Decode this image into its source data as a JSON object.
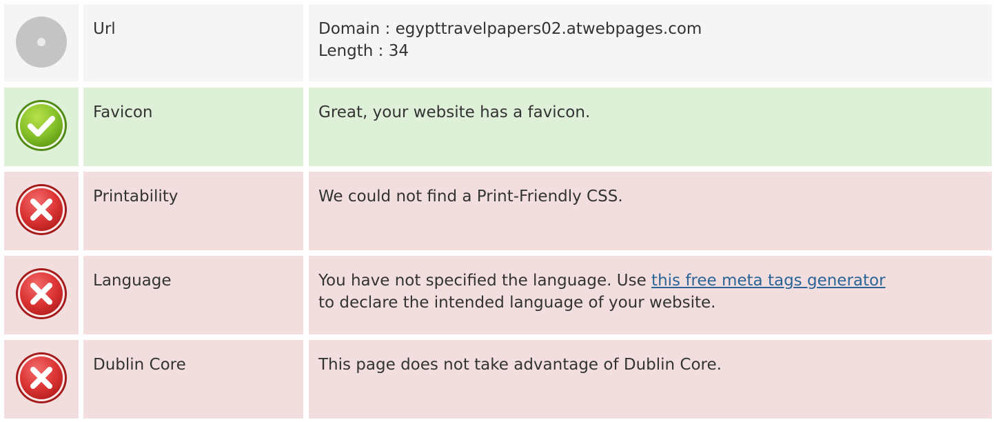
{
  "rows": [
    {
      "status": "neutral",
      "icon": "neutral-circle-icon",
      "label": "Url",
      "lines": [
        "Domain : egypttravelpapers02.atwebpages.com",
        "Length : 34"
      ]
    },
    {
      "status": "good",
      "icon": "check-circle-icon",
      "label": "Favicon",
      "text": "Great, your website has a favicon."
    },
    {
      "status": "bad",
      "icon": "error-x-icon",
      "label": "Printability",
      "text": "We could not find a Print-Friendly CSS."
    },
    {
      "status": "bad",
      "icon": "error-x-icon",
      "label": "Language",
      "text_before": "You have not specified the language. Use ",
      "link_text": "this free meta tags generator",
      "text_after": "to declare the intended language of your website."
    },
    {
      "status": "bad",
      "icon": "error-x-icon",
      "label": "Dublin Core",
      "text": "This page does not take advantage of Dublin Core."
    }
  ],
  "colors": {
    "neutral_bg": "#f5f5f5",
    "good_bg": "#dff0d8",
    "bad_bg": "#f2dede",
    "link": "#2a6496"
  }
}
